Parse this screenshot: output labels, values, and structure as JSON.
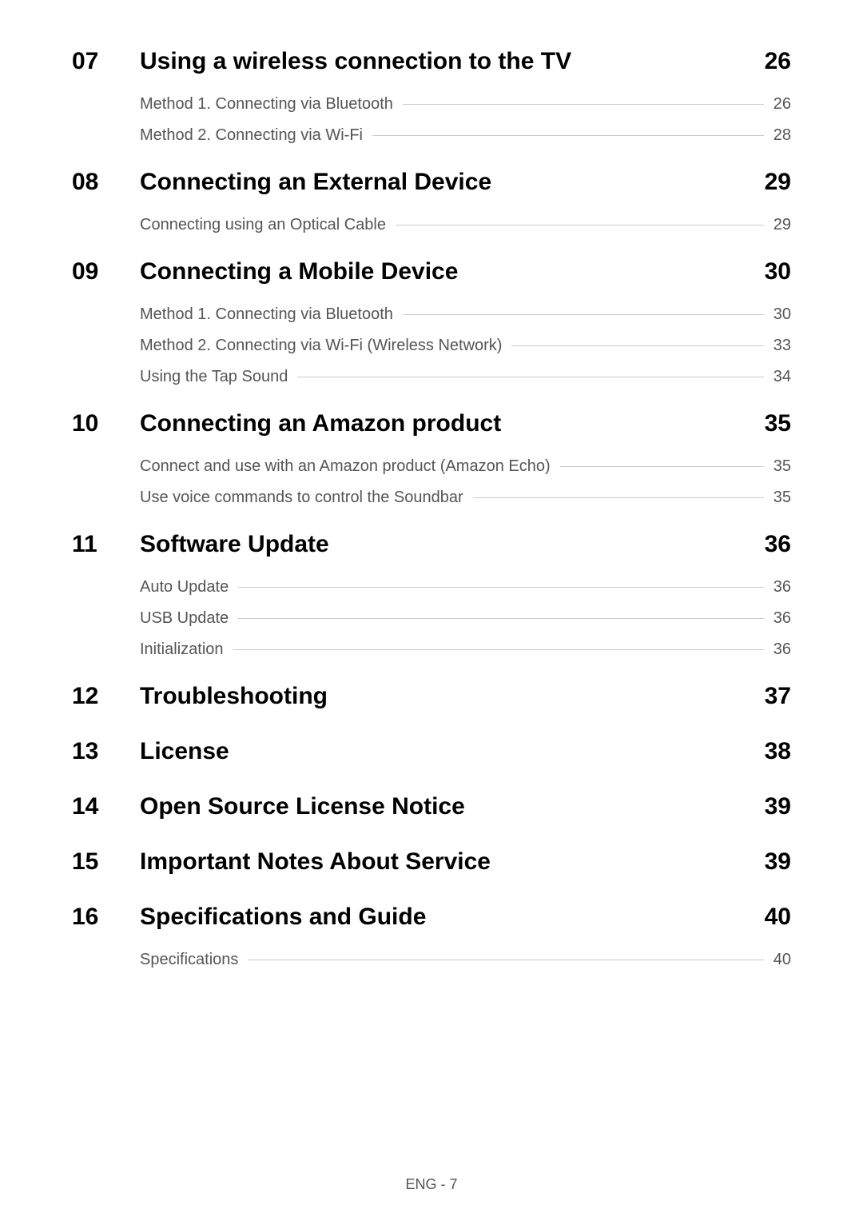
{
  "sections": [
    {
      "number": "07",
      "title": "Using a wireless connection to the TV",
      "page": "26",
      "subs": [
        {
          "title": "Method 1. Connecting via Bluetooth",
          "page": "26"
        },
        {
          "title": "Method 2. Connecting via Wi-Fi",
          "page": "28"
        }
      ]
    },
    {
      "number": "08",
      "title": "Connecting an External Device",
      "page": "29",
      "subs": [
        {
          "title": "Connecting using an Optical Cable",
          "page": "29"
        }
      ]
    },
    {
      "number": "09",
      "title": "Connecting a Mobile Device",
      "page": "30",
      "subs": [
        {
          "title": "Method 1. Connecting via Bluetooth",
          "page": "30"
        },
        {
          "title": "Method 2. Connecting via Wi-Fi (Wireless Network)",
          "page": "33"
        },
        {
          "title": "Using the Tap Sound",
          "page": "34"
        }
      ]
    },
    {
      "number": "10",
      "title": "Connecting an Amazon product",
      "page": "35",
      "subs": [
        {
          "title": "Connect and use with an Amazon product (Amazon Echo)",
          "page": "35"
        },
        {
          "title": "Use voice commands to control the Soundbar",
          "page": "35"
        }
      ]
    },
    {
      "number": "11",
      "title": "Software Update",
      "page": "36",
      "subs": [
        {
          "title": "Auto Update",
          "page": "36"
        },
        {
          "title": "USB Update",
          "page": "36"
        },
        {
          "title": "Initialization",
          "page": "36"
        }
      ]
    },
    {
      "number": "12",
      "title": "Troubleshooting",
      "page": "37",
      "subs": []
    },
    {
      "number": "13",
      "title": "License",
      "page": "38",
      "subs": []
    },
    {
      "number": "14",
      "title": "Open Source License Notice",
      "page": "39",
      "subs": []
    },
    {
      "number": "15",
      "title": "Important Notes About Service",
      "page": "39",
      "subs": []
    },
    {
      "number": "16",
      "title": "Specifications and Guide",
      "page": "40",
      "subs": [
        {
          "title": "Specifications",
          "page": "40"
        }
      ]
    }
  ],
  "footer": "ENG - 7"
}
